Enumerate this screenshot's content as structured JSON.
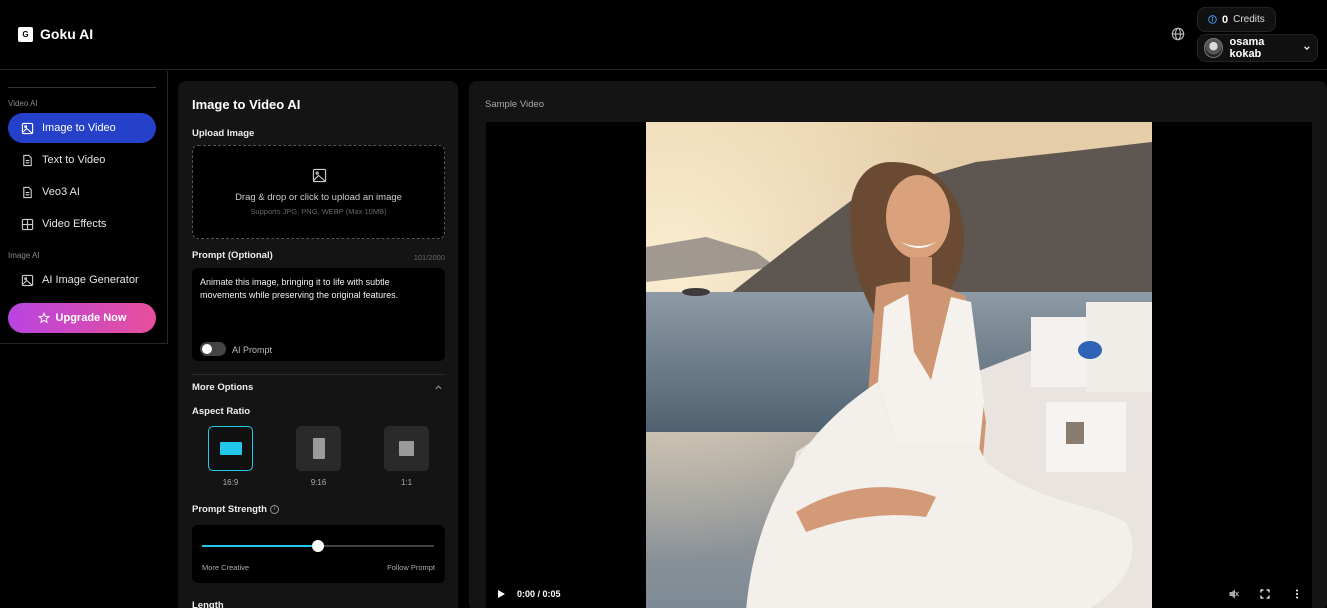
{
  "header": {
    "logo_mark": "G",
    "app_name": "Goku AI",
    "credits_count": "0",
    "credits_label": "Credits",
    "user_name": "osama kokab",
    "icons": [
      "globe-icon",
      "info-icon",
      "avatar",
      "chevron-down-icon"
    ]
  },
  "sidebar": {
    "section_video": "Video AI",
    "section_image": "Image AI",
    "items": [
      {
        "label": "Image to Video",
        "icon": "image-icon",
        "active": true
      },
      {
        "label": "Text to Video",
        "icon": "document-icon",
        "active": false
      },
      {
        "label": "Veo3 AI",
        "icon": "document-icon",
        "active": false
      },
      {
        "label": "Video Effects",
        "icon": "grid-icon",
        "active": false
      },
      {
        "label": "AI Image Generator",
        "icon": "image-icon",
        "active": false
      }
    ],
    "upgrade_label": "Upgrade Now"
  },
  "form": {
    "title": "Image to Video AI",
    "upload_label": "Upload Image",
    "upload_text": "Drag & drop or click to upload an image",
    "upload_hint": "Supports JPG, PNG, WEBP (Max 10MB)",
    "prompt_label": "Prompt (Optional)",
    "prompt_count": "101/2000",
    "prompt_value": "Animate this image, bringing it to life with subtle movements while preserving the original features.",
    "ai_prompt_label": "AI Prompt",
    "ai_prompt_enabled": false,
    "more_options_label": "More Options",
    "aspect_ratio_label": "Aspect Ratio",
    "aspect_ratios": [
      {
        "label": "16:9",
        "selected": true
      },
      {
        "label": "9:16",
        "selected": false
      },
      {
        "label": "1:1",
        "selected": false
      }
    ],
    "prompt_strength_label": "Prompt Strength",
    "prompt_strength_value": 0.5,
    "slider_left_label": "More Creative",
    "slider_right_label": "Follow Prompt",
    "length_label": "Length"
  },
  "preview": {
    "label": "Sample Video",
    "time": "0:00 / 0:05",
    "accent": "#22c8e8"
  }
}
